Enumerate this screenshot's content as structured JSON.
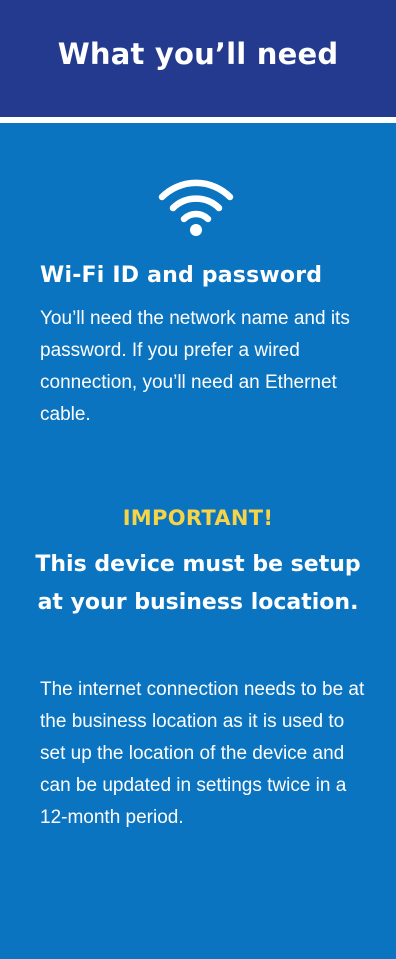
{
  "header": {
    "title": "What you’ll need",
    "background": "#233a8e"
  },
  "panel": {
    "background": "#0a74c0",
    "icon": "wifi-icon",
    "heading": "Wi-Fi ID and password",
    "description": "You’ll need the network name and its password. If you prefer a wired connection, you’ll need an Ethernet cable.",
    "important_label": "IMPORTANT!",
    "important_color": "#f7d447",
    "important_message": "This device must be setup at your business location.",
    "details": "The internet connection needs to be at the business location as it is used to set up the location of the device and can be updated in settings twice in a 12-month period."
  }
}
